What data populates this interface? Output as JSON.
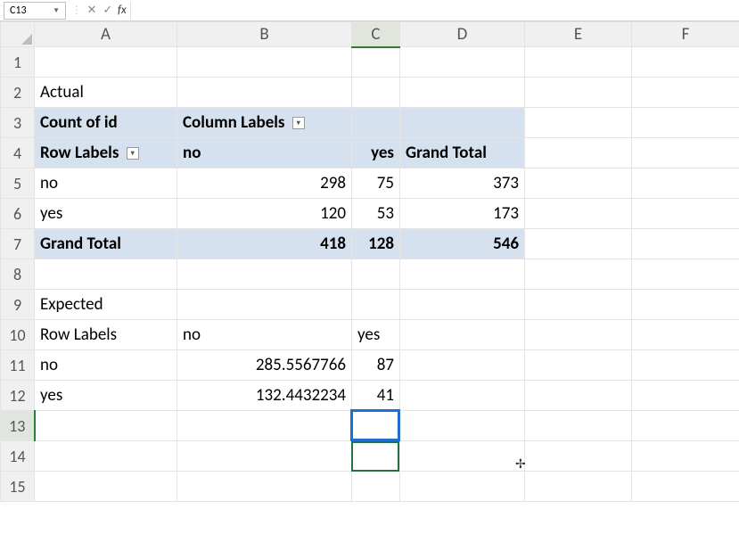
{
  "namebox": "C13",
  "formula": "",
  "columns": [
    "A",
    "B",
    "C",
    "D",
    "E",
    "F"
  ],
  "rows": [
    "1",
    "2",
    "3",
    "4",
    "5",
    "6",
    "7",
    "8",
    "9",
    "10",
    "11",
    "12",
    "13",
    "14",
    "15"
  ],
  "activeCol": "C",
  "activeRow": "13",
  "cells": {
    "A2": "Actual",
    "A3": "Count of id",
    "B3": "Column Labels",
    "A4": "Row Labels",
    "B4": "no",
    "C4": "yes",
    "D4": "Grand Total",
    "A5": "no",
    "B5": "298",
    "C5": "75",
    "D5": "373",
    "A6": "yes",
    "B6": "120",
    "C6": "53",
    "D6": "173",
    "A7": "Grand Total",
    "B7": "418",
    "C7": "128",
    "D7": "546",
    "A9": "Expected",
    "A10": "Row Labels",
    "B10": "no",
    "C10": "yes",
    "A11": "no",
    "B11": "285.5567766",
    "C11": "87",
    "A12": "yes",
    "B12": "132.4432234",
    "C12": "41"
  },
  "chart_data": [
    {
      "type": "table",
      "title": "Actual — Count of id",
      "row_labels": [
        "no",
        "yes",
        "Grand Total"
      ],
      "column_labels": [
        "no",
        "yes",
        "Grand Total"
      ],
      "values": [
        [
          298,
          75,
          373
        ],
        [
          120,
          53,
          173
        ],
        [
          418,
          128,
          546
        ]
      ]
    },
    {
      "type": "table",
      "title": "Expected",
      "row_labels": [
        "no",
        "yes"
      ],
      "column_labels": [
        "no",
        "yes"
      ],
      "values": [
        [
          285.5567766,
          87
        ],
        [
          132.4432234,
          41
        ]
      ]
    }
  ]
}
